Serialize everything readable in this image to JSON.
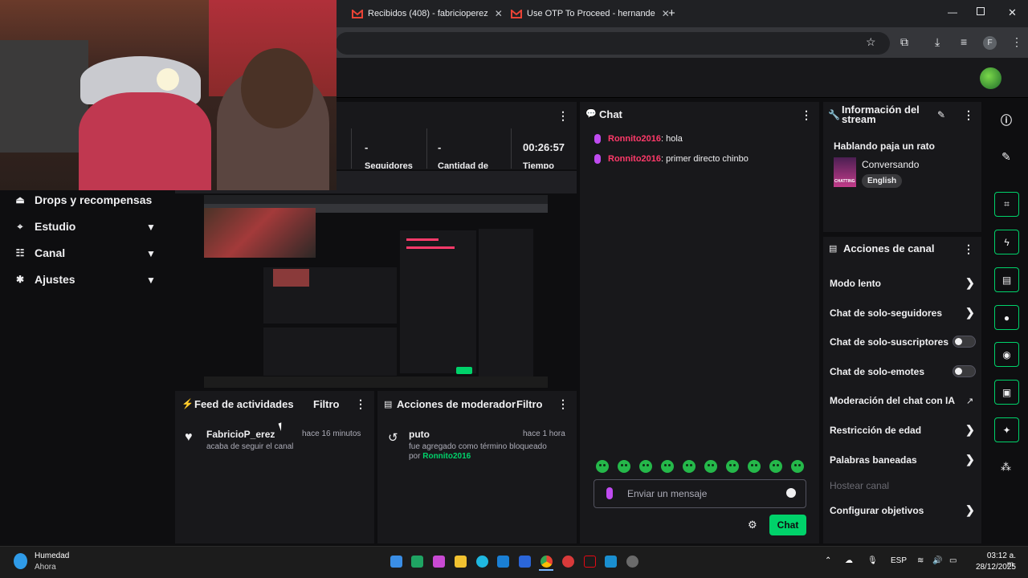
{
  "browser": {
    "tabs": [
      {
        "label": "Recibidos (408) - fabricioperez"
      },
      {
        "label": "Use OTP To Proceed - hernande"
      }
    ],
    "profile_initial": "F"
  },
  "stats": {
    "followers_value": "-",
    "followers_label": "Seguidores",
    "count_value": "-",
    "count_label": "Cantidad de",
    "time_value": "00:26:57",
    "time_label": "Tiempo"
  },
  "sidebar": {
    "items": [
      {
        "label": "Drops y recompensas",
        "icon": "drops-icon"
      },
      {
        "label": "Estudio",
        "icon": "studio-icon"
      },
      {
        "label": "Canal",
        "icon": "channel-icon"
      },
      {
        "label": "Ajustes",
        "icon": "settings-icon"
      }
    ]
  },
  "activity_feed": {
    "title": "Feed de actividades",
    "filter": "Filtro",
    "event_user": "FabricioP_erez",
    "event_time": "hace 16 minutos",
    "event_text": "acaba de seguir el canal"
  },
  "mod_actions": {
    "title": "Acciones de moderador",
    "filter": "Filtro",
    "term": "puto",
    "time": "hace 1 hora",
    "text": "fue agregado como término bloqueado",
    "by_prefix": "por",
    "by_user": "Ronnito2016"
  },
  "chat": {
    "title": "Chat",
    "messages": [
      {
        "user": "Ronnito2016",
        "text": ": hola"
      },
      {
        "user": "Ronnito2016",
        "text": ": primer directo chinbo"
      }
    ],
    "input_placeholder": "Enviar un mensaje",
    "send_button": "Chat"
  },
  "stream_info": {
    "title": "Información del stream",
    "stream_title": "Hablando paja un rato",
    "category": "Conversando",
    "language_tag": "English",
    "category_art_text": "CHATTING"
  },
  "channel_actions": {
    "title": "Acciones de canal",
    "items": [
      {
        "label": "Modo lento"
      },
      {
        "label": "Chat de solo-seguidores"
      },
      {
        "label": "Chat de solo-suscriptores"
      },
      {
        "label": "Chat de solo-emotes"
      },
      {
        "label": "Moderación del chat con IA"
      },
      {
        "label": "Restricción de edad"
      },
      {
        "label": "Palabras baneadas"
      },
      {
        "label": "Hostear canal"
      },
      {
        "label": "Configurar objetivos"
      }
    ]
  },
  "taskbar": {
    "weather_title": "Humedad",
    "weather_sub": "Ahora",
    "lang": "ESP",
    "time": "03:12 a. m.",
    "date": "28/12/2025"
  },
  "colors": {
    "twitch_green": "#00d26a",
    "chat_user": "#ff3a6a",
    "mention_green": "#00d26a",
    "panel_bg": "#18181b",
    "page_bg": "#0e0e10"
  }
}
